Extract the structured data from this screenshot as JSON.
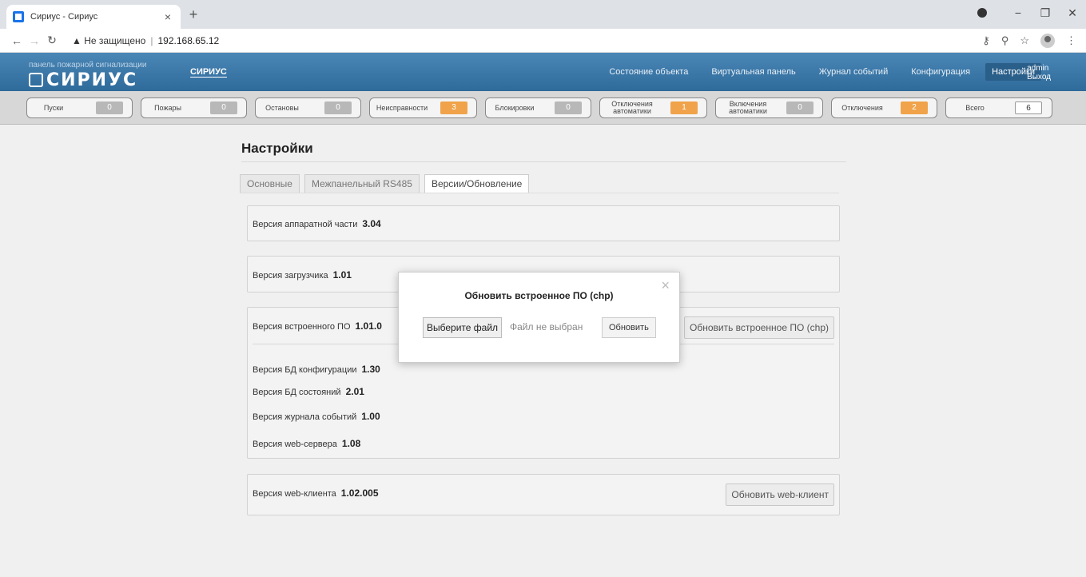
{
  "browser": {
    "tab_title": "Сириус - Сириус",
    "url_warning": "Не защищено",
    "url": "192.168.65.12"
  },
  "header": {
    "logo_subtitle": "панель пожарной сигнализации",
    "logo_title": "СИРИУС",
    "brand_link": "СИРИУС",
    "nav": [
      "Состояние объекта",
      "Виртуальная панель",
      "Журнал событий",
      "Конфигурация",
      "Настройки"
    ],
    "user": "admin",
    "logout": "Выход"
  },
  "counters": [
    {
      "label": "Пуски",
      "value": "0",
      "color": "gray"
    },
    {
      "label": "Пожары",
      "value": "0",
      "color": "gray"
    },
    {
      "label": "Остановы",
      "value": "0",
      "color": "gray"
    },
    {
      "label": "Неисправности",
      "value": "3",
      "color": "orange"
    },
    {
      "label": "Блокировки",
      "value": "0",
      "color": "gray"
    },
    {
      "label": "Отключения автоматики",
      "value": "1",
      "color": "orange"
    },
    {
      "label": "Включения автоматики",
      "value": "0",
      "color": "gray"
    },
    {
      "label": "Отключения",
      "value": "2",
      "color": "orange"
    },
    {
      "label": "Всего",
      "value": "6",
      "color": "white"
    }
  ],
  "page": {
    "title": "Настройки",
    "tabs": [
      "Основные",
      "Межпанельный RS485",
      "Версии/Обновление"
    ],
    "hardware_label": "Версия аппаратной части",
    "hardware_value": "3.04",
    "bootloader_label": "Версия загрузчика",
    "bootloader_value": "1.01",
    "firmware_label": "Версия встроенного ПО",
    "firmware_value": "1.01.0",
    "firmware_button": "Обновить встроенное ПО (chp)",
    "db_config_label": "Версия БД конфигурации",
    "db_config_value": "1.30",
    "db_state_label": "Версия БД состояний",
    "db_state_value": "2.01",
    "journal_label": "Версия журнала событий",
    "journal_value": "1.00",
    "webserver_label": "Версия web-сервера",
    "webserver_value": "1.08",
    "webclient_label": "Версия web-клиента",
    "webclient_value": "1.02.005",
    "webclient_button": "Обновить web-клиент"
  },
  "modal": {
    "title": "Обновить встроенное ПО (chp)",
    "close": "×",
    "choose_file": "Выберите файл",
    "no_file": "Файл не выбран",
    "update": "Обновить"
  },
  "colors": {
    "header_blue": "#3b78a8",
    "counter_orange": "#f0a34a",
    "counter_gray": "#b8b8b8"
  }
}
